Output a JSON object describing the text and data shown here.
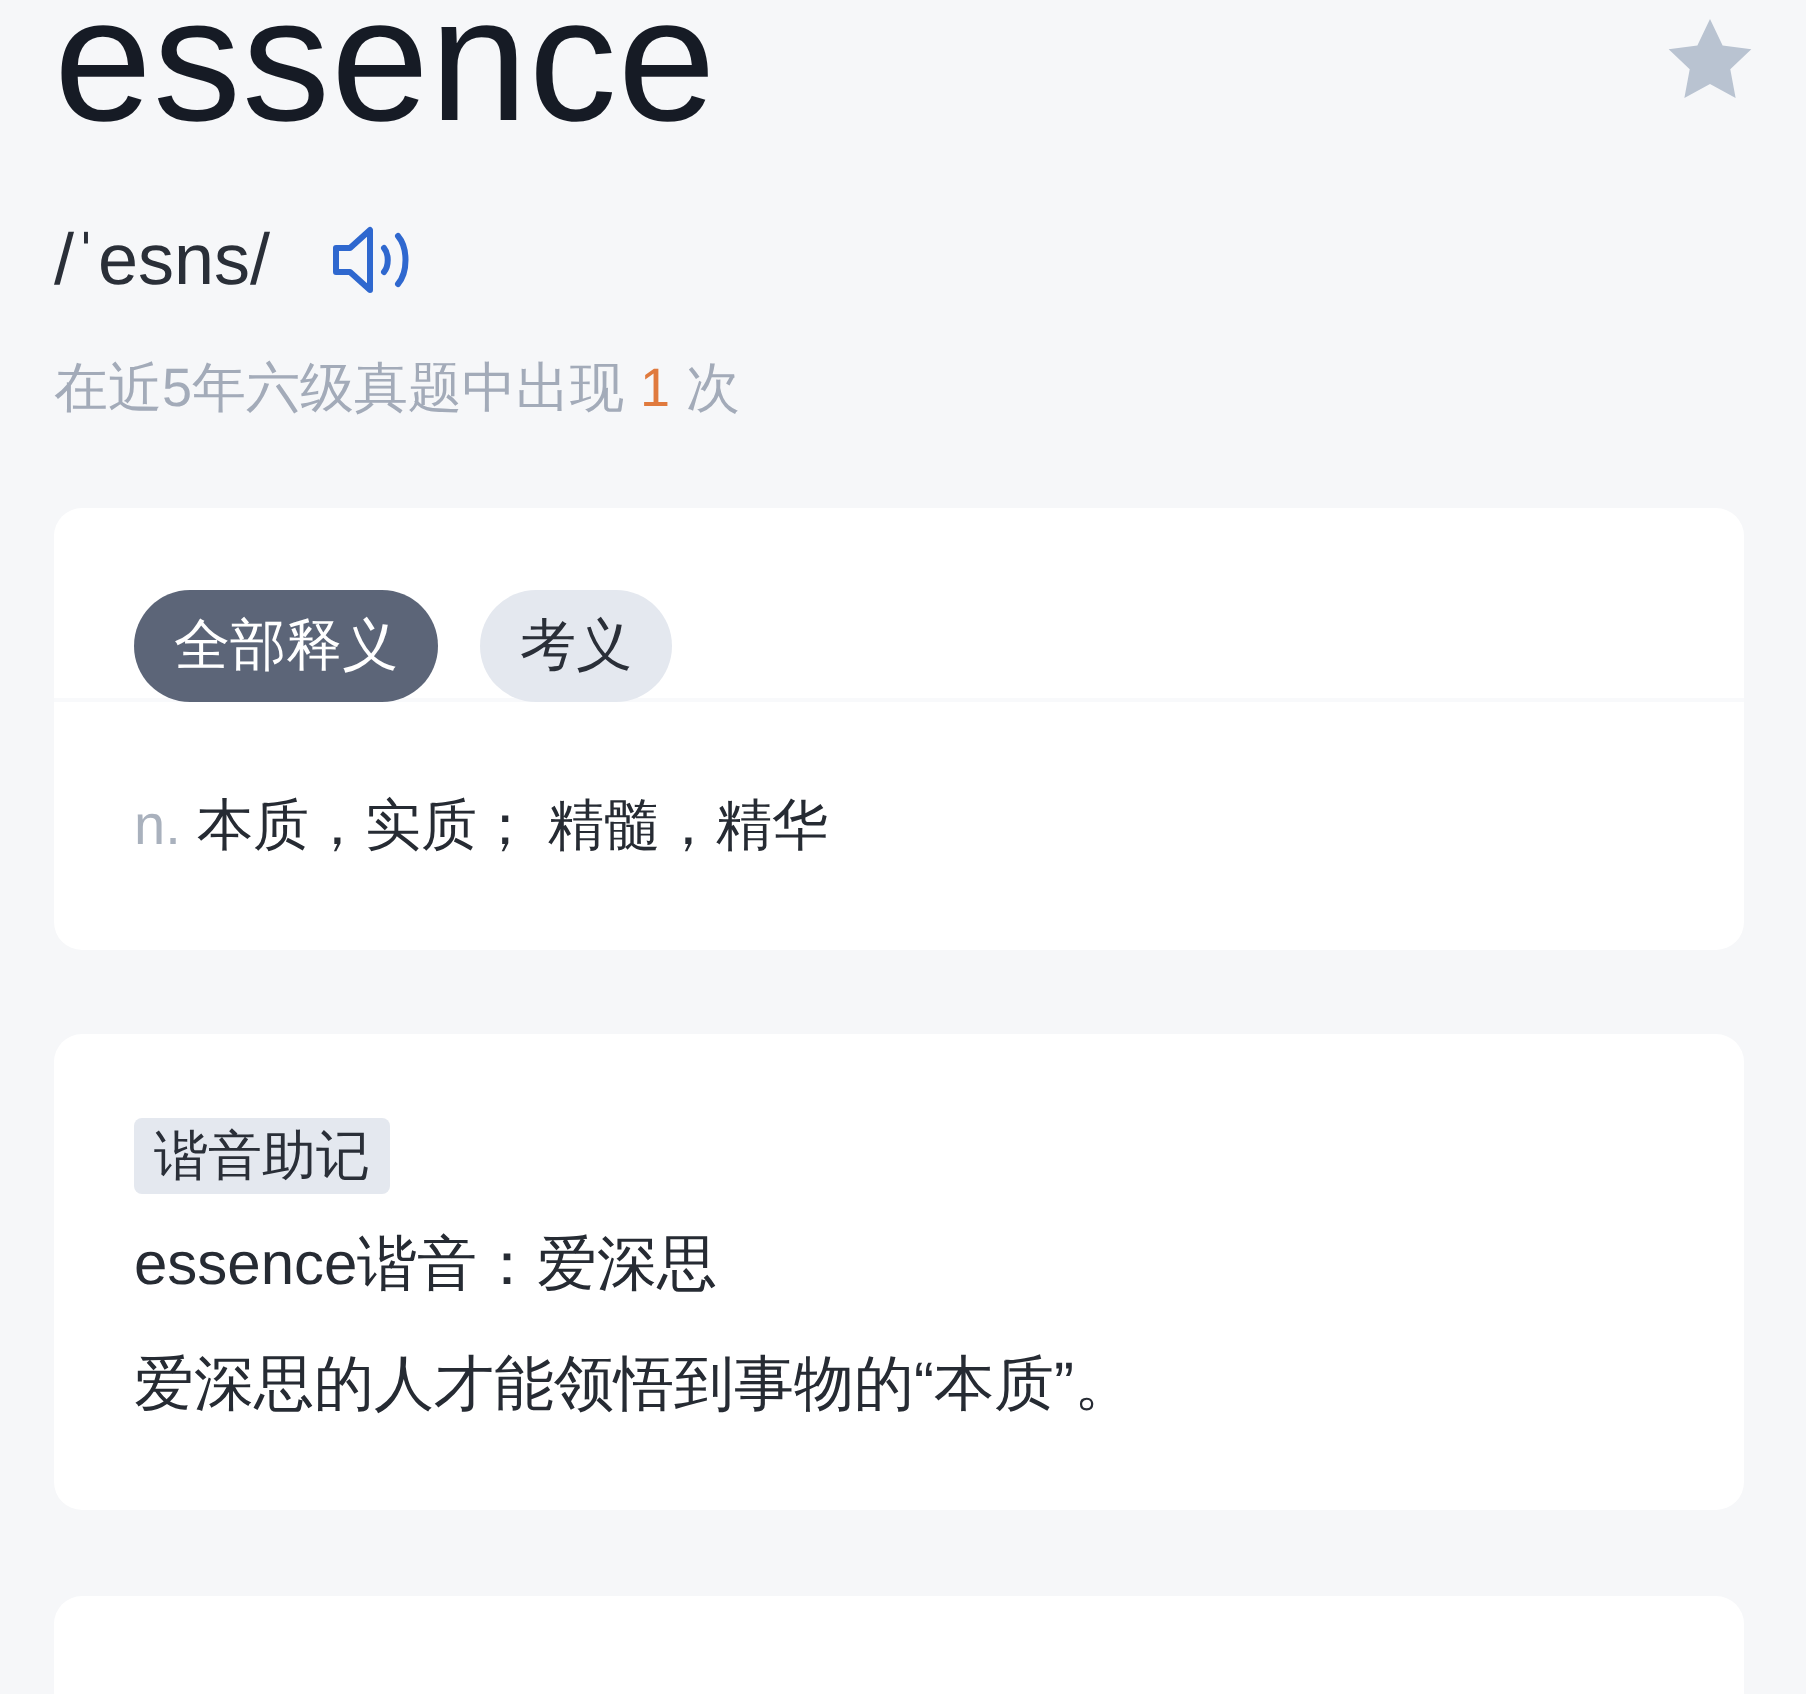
{
  "word": {
    "text": "essence",
    "favorite": false
  },
  "phonetic": {
    "text": "/ˈesns/"
  },
  "exam_frequency": {
    "prefix": "在近5年六级真题中出现",
    "count": "1",
    "suffix": "次"
  },
  "tabs": [
    {
      "label": "全部释义",
      "selected": true
    },
    {
      "label": "考义",
      "selected": false
    }
  ],
  "definitions": [
    {
      "pos": "n.",
      "meaning": "本质，实质； 精髓，精华"
    }
  ],
  "mnemonic": {
    "tag": "谐音助记",
    "lines": [
      "essence谐音：爱深思",
      "爱深思的人才能领悟到事物的“本质”。"
    ]
  }
}
